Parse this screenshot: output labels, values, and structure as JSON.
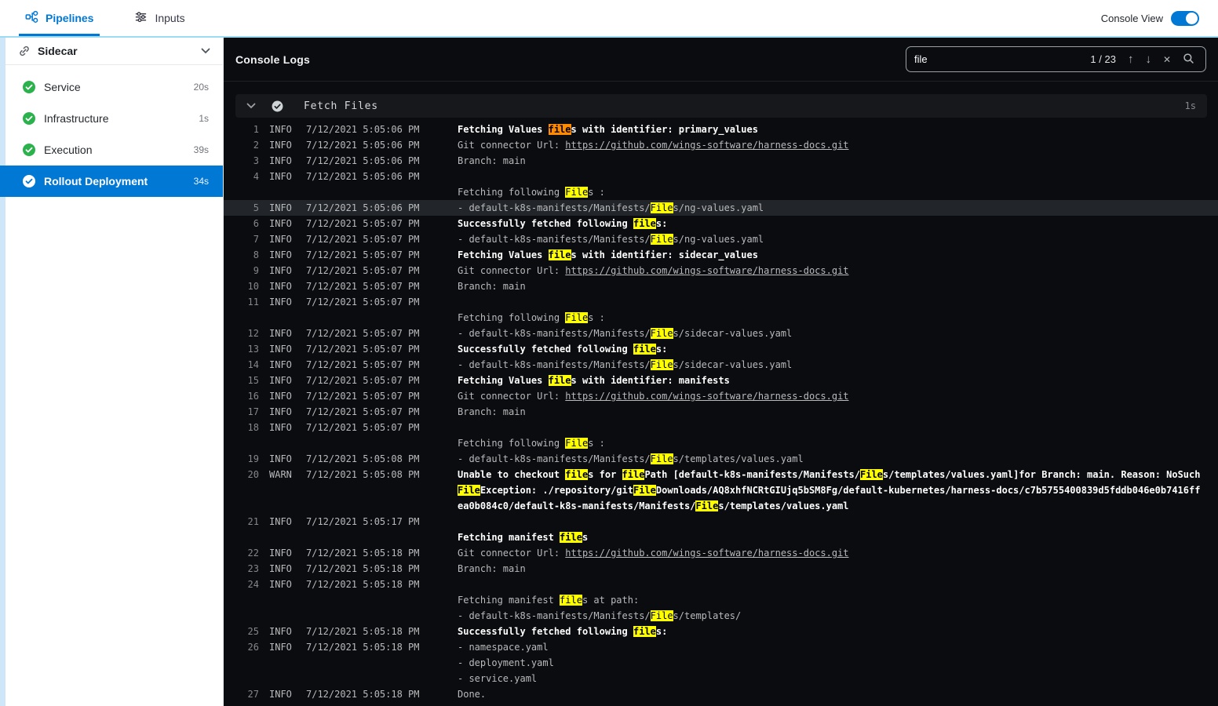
{
  "topbar": {
    "tabs": [
      {
        "label": "Pipelines"
      },
      {
        "label": "Inputs"
      }
    ],
    "console_view_label": "Console View",
    "console_view_on": true
  },
  "sidebar": {
    "title": "Sidecar",
    "items": [
      {
        "label": "Service",
        "duration": "20s",
        "status": "success",
        "selected": false
      },
      {
        "label": "Infrastructure",
        "duration": "1s",
        "status": "success",
        "selected": false
      },
      {
        "label": "Execution",
        "duration": "39s",
        "status": "success",
        "selected": false
      },
      {
        "label": "Rollout Deployment",
        "duration": "34s",
        "status": "success",
        "selected": true
      }
    ]
  },
  "console": {
    "title": "Console Logs",
    "search": {
      "value": "file",
      "counter": "1 / 23"
    },
    "section": {
      "label": "Fetch Files",
      "duration": "1s"
    },
    "logs": [
      {
        "n": "1",
        "lv": "INFO",
        "t": "7/12/2021 5:05:06 PM",
        "s": [
          [
            "Fetching Values ",
            "b"
          ],
          [
            "file",
            "ab"
          ],
          [
            "s with identifier: primary_values",
            "b"
          ]
        ]
      },
      {
        "n": "2",
        "lv": "INFO",
        "t": "7/12/2021 5:05:06 PM",
        "s": [
          [
            "Git connector Url: ",
            ""
          ],
          [
            "https://github.com/wings-software/harness-docs.git",
            "l"
          ]
        ]
      },
      {
        "n": "3",
        "lv": "INFO",
        "t": "7/12/2021 5:05:06 PM",
        "s": [
          [
            "Branch: main",
            ""
          ]
        ]
      },
      {
        "n": "4",
        "lv": "INFO",
        "t": "7/12/2021 5:05:06 PM",
        "s": []
      },
      {
        "s": [
          [
            "Fetching following ",
            ""
          ],
          [
            "File",
            "h"
          ],
          [
            "s :",
            ""
          ]
        ]
      },
      {
        "n": "5",
        "lv": "INFO",
        "t": "7/12/2021 5:05:06 PM",
        "sel": true,
        "s": [
          [
            "- default-k8s-manifests/Manifests/",
            ""
          ],
          [
            "File",
            "h"
          ],
          [
            "s/ng-values.yaml",
            ""
          ]
        ]
      },
      {
        "n": "6",
        "lv": "INFO",
        "t": "7/12/2021 5:05:07 PM",
        "s": [
          [
            "Successfully fetched following ",
            "b"
          ],
          [
            "file",
            "hb"
          ],
          [
            "s:",
            "b"
          ]
        ]
      },
      {
        "n": "7",
        "lv": "INFO",
        "t": "7/12/2021 5:05:07 PM",
        "s": [
          [
            "- default-k8s-manifests/Manifests/",
            ""
          ],
          [
            "File",
            "h"
          ],
          [
            "s/ng-values.yaml",
            ""
          ]
        ]
      },
      {
        "n": "8",
        "lv": "INFO",
        "t": "7/12/2021 5:05:07 PM",
        "s": [
          [
            "Fetching Values ",
            "b"
          ],
          [
            "file",
            "hb"
          ],
          [
            "s with identifier: sidecar_values",
            "b"
          ]
        ]
      },
      {
        "n": "9",
        "lv": "INFO",
        "t": "7/12/2021 5:05:07 PM",
        "s": [
          [
            "Git connector Url: ",
            ""
          ],
          [
            "https://github.com/wings-software/harness-docs.git",
            "l"
          ]
        ]
      },
      {
        "n": "10",
        "lv": "INFO",
        "t": "7/12/2021 5:05:07 PM",
        "s": [
          [
            "Branch: main",
            ""
          ]
        ]
      },
      {
        "n": "11",
        "lv": "INFO",
        "t": "7/12/2021 5:05:07 PM",
        "s": []
      },
      {
        "s": [
          [
            "Fetching following ",
            ""
          ],
          [
            "File",
            "h"
          ],
          [
            "s :",
            ""
          ]
        ]
      },
      {
        "n": "12",
        "lv": "INFO",
        "t": "7/12/2021 5:05:07 PM",
        "s": [
          [
            "- default-k8s-manifests/Manifests/",
            ""
          ],
          [
            "File",
            "h"
          ],
          [
            "s/sidecar-values.yaml",
            ""
          ]
        ]
      },
      {
        "n": "13",
        "lv": "INFO",
        "t": "7/12/2021 5:05:07 PM",
        "s": [
          [
            "Successfully fetched following ",
            "b"
          ],
          [
            "file",
            "hb"
          ],
          [
            "s:",
            "b"
          ]
        ]
      },
      {
        "n": "14",
        "lv": "INFO",
        "t": "7/12/2021 5:05:07 PM",
        "s": [
          [
            "- default-k8s-manifests/Manifests/",
            ""
          ],
          [
            "File",
            "h"
          ],
          [
            "s/sidecar-values.yaml",
            ""
          ]
        ]
      },
      {
        "n": "15",
        "lv": "INFO",
        "t": "7/12/2021 5:05:07 PM",
        "s": [
          [
            "Fetching Values ",
            "b"
          ],
          [
            "file",
            "hb"
          ],
          [
            "s with identifier: manifests",
            "b"
          ]
        ]
      },
      {
        "n": "16",
        "lv": "INFO",
        "t": "7/12/2021 5:05:07 PM",
        "s": [
          [
            "Git connector Url: ",
            ""
          ],
          [
            "https://github.com/wings-software/harness-docs.git",
            "l"
          ]
        ]
      },
      {
        "n": "17",
        "lv": "INFO",
        "t": "7/12/2021 5:05:07 PM",
        "s": [
          [
            "Branch: main",
            ""
          ]
        ]
      },
      {
        "n": "18",
        "lv": "INFO",
        "t": "7/12/2021 5:05:07 PM",
        "s": []
      },
      {
        "s": [
          [
            "Fetching following ",
            ""
          ],
          [
            "File",
            "h"
          ],
          [
            "s :",
            ""
          ]
        ]
      },
      {
        "n": "19",
        "lv": "INFO",
        "t": "7/12/2021 5:05:08 PM",
        "s": [
          [
            "- default-k8s-manifests/Manifests/",
            ""
          ],
          [
            "File",
            "h"
          ],
          [
            "s/templates/values.yaml",
            ""
          ]
        ]
      },
      {
        "n": "20",
        "lv": "WARN",
        "t": "7/12/2021 5:05:08 PM",
        "s": [
          [
            "Unable to checkout ",
            "b"
          ],
          [
            "file",
            "hb"
          ],
          [
            "s for ",
            "b"
          ],
          [
            "file",
            "hb"
          ],
          [
            "Path [default-k8s-manifests/Manifests/",
            "b"
          ],
          [
            "File",
            "hb"
          ],
          [
            "s/templates/values.yaml]for Branch: main. Reason: NoSuch",
            "b"
          ],
          [
            "File",
            "hb"
          ],
          [
            "Exception: ./repository/git",
            "b"
          ],
          [
            "File",
            "hb"
          ],
          [
            "Downloads/AQ8xhfNCRtGIUjq5bSM8Fg/default-kubernetes/harness-docs/c7b5755400839d5fddb046e0b7416ffea0b084c0/default-k8s-manifests/Manifests/",
            "b"
          ],
          [
            "File",
            "hb"
          ],
          [
            "s/templates/values.yaml",
            "b"
          ]
        ]
      },
      {
        "n": "21",
        "lv": "INFO",
        "t": "7/12/2021 5:05:17 PM",
        "s": []
      },
      {
        "s": [
          [
            "Fetching manifest ",
            "b"
          ],
          [
            "file",
            "hb"
          ],
          [
            "s",
            "b"
          ]
        ]
      },
      {
        "n": "22",
        "lv": "INFO",
        "t": "7/12/2021 5:05:18 PM",
        "s": [
          [
            "Git connector Url: ",
            ""
          ],
          [
            "https://github.com/wings-software/harness-docs.git",
            "l"
          ]
        ]
      },
      {
        "n": "23",
        "lv": "INFO",
        "t": "7/12/2021 5:05:18 PM",
        "s": [
          [
            "Branch: main",
            ""
          ]
        ]
      },
      {
        "n": "24",
        "lv": "INFO",
        "t": "7/12/2021 5:05:18 PM",
        "s": []
      },
      {
        "s": [
          [
            "Fetching manifest ",
            ""
          ],
          [
            "file",
            "h"
          ],
          [
            "s at path:",
            ""
          ]
        ]
      },
      {
        "s": [
          [
            "- default-k8s-manifests/Manifests/",
            ""
          ],
          [
            "File",
            "h"
          ],
          [
            "s/templates/",
            ""
          ]
        ]
      },
      {
        "n": "25",
        "lv": "INFO",
        "t": "7/12/2021 5:05:18 PM",
        "s": [
          [
            "Successfully fetched following ",
            "b"
          ],
          [
            "file",
            "hb"
          ],
          [
            "s:",
            "b"
          ]
        ]
      },
      {
        "n": "26",
        "lv": "INFO",
        "t": "7/12/2021 5:05:18 PM",
        "s": [
          [
            "- namespace.yaml",
            ""
          ]
        ]
      },
      {
        "s": [
          [
            "- deployment.yaml",
            ""
          ]
        ]
      },
      {
        "s": [
          [
            "- service.yaml",
            ""
          ]
        ]
      },
      {
        "n": "27",
        "lv": "INFO",
        "t": "7/12/2021 5:05:18 PM",
        "s": [
          [
            "Done.",
            ""
          ]
        ]
      }
    ]
  },
  "colors": {
    "accent": "#0278d5",
    "success": "#2bb24c",
    "match_highlight": "#ffff00",
    "active_match_highlight": "#ff8a00",
    "console_background": "#0a0c0f"
  }
}
